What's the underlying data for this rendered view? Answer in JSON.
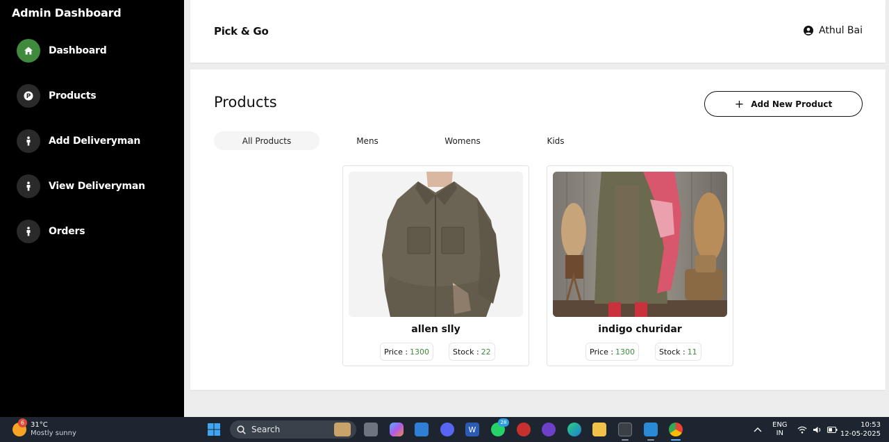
{
  "sidebar": {
    "title": "Admin Dashboard",
    "items": [
      {
        "label": "Dashboard",
        "icon": "home-icon",
        "active": true
      },
      {
        "label": "Products",
        "icon": "p-badge-icon"
      },
      {
        "label": "Add Deliveryman",
        "icon": "person-icon"
      },
      {
        "label": "View Deliveryman",
        "icon": "person-icon"
      },
      {
        "label": "Orders",
        "icon": "person-icon"
      }
    ]
  },
  "header": {
    "site_name": "Pick & Go",
    "user_name": "Athul Bai",
    "user_icon": "user-circle-icon"
  },
  "main": {
    "title": "Products",
    "add_button": "Add New Product",
    "tabs": [
      {
        "label": "All Products",
        "active": true
      },
      {
        "label": "Mens"
      },
      {
        "label": "Womens"
      },
      {
        "label": "Kids"
      }
    ],
    "products": [
      {
        "name": "allen slly",
        "price_label": "Price :",
        "price": "1300",
        "stock_label": "Stock :",
        "stock": "22",
        "image": "olive-shirt-photo"
      },
      {
        "name": "indigo churidar",
        "price_label": "Price :",
        "price": "1300",
        "stock_label": "Stock :",
        "stock": "11",
        "image": "churidar-photo"
      }
    ]
  },
  "taskbar": {
    "weather_badge": "6",
    "temperature": "31°C",
    "weather": "Mostly sunny",
    "search_placeholder": "Search",
    "whatsapp_badge": "28",
    "lang_top": "ENG",
    "lang_bottom": "IN",
    "time": "10:53",
    "date": "12-05-2025"
  },
  "colors": {
    "sidebar_bg": "#000000",
    "accent_green": "#3f8a3c",
    "page_bg": "#ededed",
    "taskbar_bg": "#1d2530"
  }
}
